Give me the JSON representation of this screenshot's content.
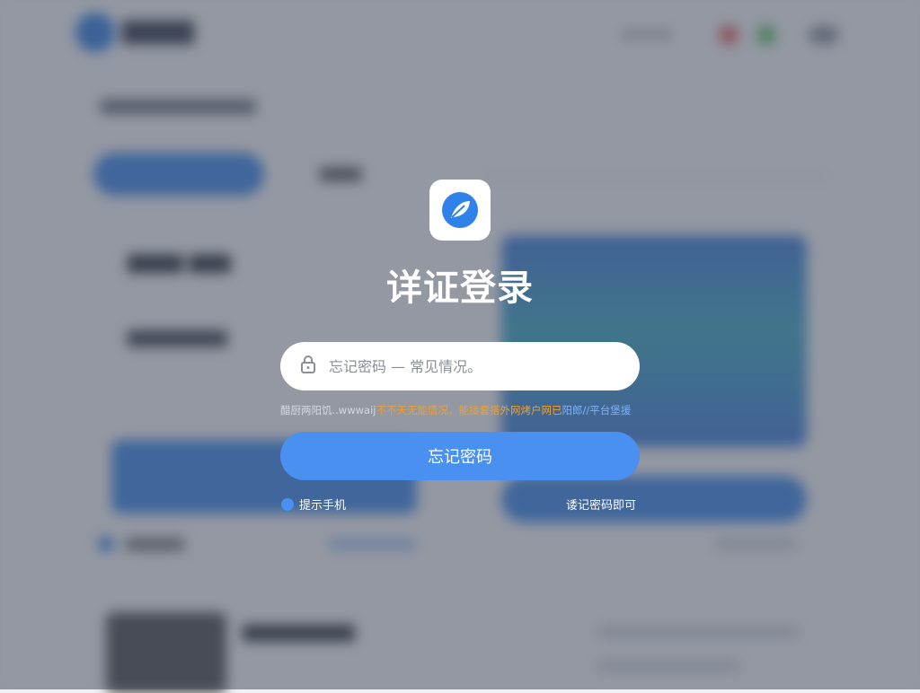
{
  "login": {
    "title": "详证登录",
    "password_placeholder": "忘记密码 — 常见情况。",
    "notice": {
      "part1": "醋厨两阳饥..wwwaij",
      "part2": "不不天无能情况，",
      "part3": "能接套搭外网烤户网已",
      "part4": "阳郎//平台堡援"
    },
    "primary_button": "忘记密码",
    "left_option": "提示手机",
    "right_link": "诿记密码即可"
  },
  "colors": {
    "accent": "#4a90f0",
    "notice_orange": "#f0a030",
    "notice_blue": "#7fb3ff"
  },
  "icons": {
    "app": "feather-logo-icon",
    "lock": "lock-icon"
  }
}
